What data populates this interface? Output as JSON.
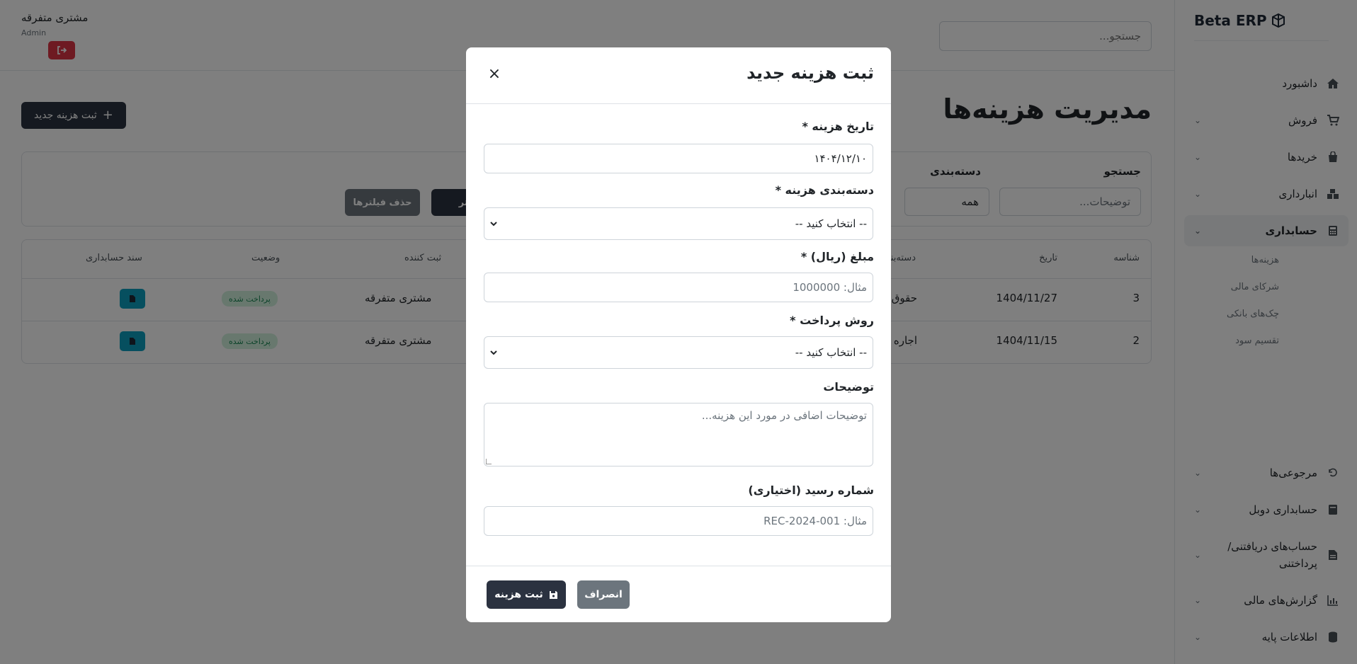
{
  "app": {
    "brand": "Beta ERP"
  },
  "topbar": {
    "search_placeholder": "جستجو...",
    "user_name": "مشتری متفرقه",
    "user_role": "Admin"
  },
  "sidebar": {
    "items": [
      {
        "label": "داشبورد",
        "icon": "home-icon"
      },
      {
        "label": "فروش",
        "icon": "cart-icon"
      },
      {
        "label": "خریدها",
        "icon": "bag-icon"
      },
      {
        "label": "انبارداری",
        "icon": "warehouse-icon"
      },
      {
        "label": "حسابداری",
        "icon": "calculator-icon"
      },
      {
        "label": "مرجوعی‌ها",
        "icon": "undo-icon"
      },
      {
        "label": "حسابداری دوبل",
        "icon": "book-icon"
      },
      {
        "label": "حساب‌های دریافتنی/\nپرداختنی",
        "label_line1": "حساب‌های دریافتنی/",
        "label_line2": "پرداختنی",
        "icon": "invoice-icon"
      },
      {
        "label": "گزارش‌های مالی",
        "icon": "chart-icon"
      },
      {
        "label": "اطلاعات پایه",
        "icon": "database-icon"
      }
    ],
    "subitems": [
      "هزینه‌ها",
      "شرکای مالی",
      "چک‌های بانکی",
      "تقسیم سود"
    ]
  },
  "page": {
    "title": "مدیریت هزینه‌ها",
    "new_button": "ثبت هزینه جدید"
  },
  "filters": {
    "search_label": "جستجو",
    "search_placeholder": "توضیحات...",
    "category_label": "دسته‌بندی",
    "category_value": "همه",
    "apply_button": "فیلتر",
    "clear_button": "حذف فیلترها"
  },
  "table": {
    "headers": {
      "id": "شناسه",
      "date": "تاریخ",
      "category": "دسته‌بندی",
      "registrar": "ثبت کننده",
      "status": "وضعیت",
      "voucher": "سند حسابداری"
    },
    "rows": [
      {
        "id": "3",
        "date": "1404/11/27",
        "category": "حقوق",
        "registrar": "مشتری متفرقه",
        "status": "پرداخت شده"
      },
      {
        "id": "2",
        "date": "1404/11/15",
        "category": "اجاره",
        "registrar": "مشتری متفرقه",
        "status": "پرداخت شده"
      }
    ]
  },
  "modal": {
    "title": "ثبت هزینه جدید",
    "date_label": "تاریخ هزینه *",
    "date_value": "۱۴۰۴/۱۲/۱۰",
    "category_label": "دسته‌بندی هزینه *",
    "category_selected": "-- انتخاب کنید --",
    "amount_label": "مبلغ (ریال) *",
    "amount_placeholder": "مثال: 1000000",
    "payment_label": "روش پرداخت *",
    "payment_selected": "-- انتخاب کنید --",
    "description_label": "توضیحات",
    "description_placeholder": "توضیحات اضافی در مورد این هزینه...",
    "receipt_label": "شماره رسید (اختیاری)",
    "receipt_placeholder": "مثال: REC-2024-001",
    "save_button": "ثبت هزینه",
    "cancel_button": "انصراف"
  },
  "colors": {
    "primary_dark": "#2b3240",
    "danger": "#dc3545",
    "secondary": "#6c757d",
    "success_bg": "#d1f0dc",
    "success_text": "#198754",
    "info": "#0d9fbf"
  }
}
